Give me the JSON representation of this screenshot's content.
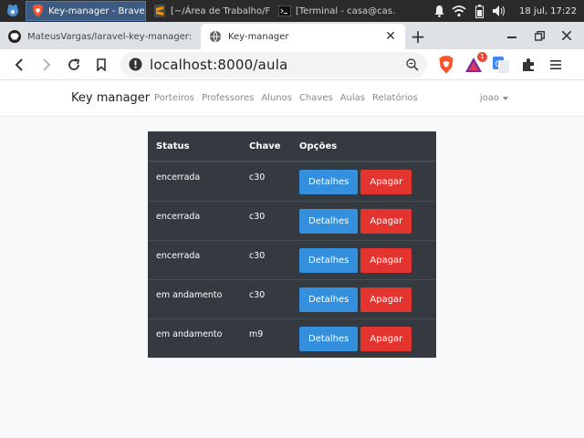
{
  "taskbar": {
    "tasks": [
      {
        "icon": "brave-icon",
        "title": "Key-manager - Brave",
        "active": true
      },
      {
        "icon": "sublime-text-icon",
        "title": "[~/Área de Trabalho/F…",
        "active": false
      },
      {
        "icon": "terminal-icon",
        "title": "[Terminal - casa@cas…",
        "active": false
      }
    ],
    "clock": "18 jul, 17:22"
  },
  "browser": {
    "tabs": [
      {
        "icon": "github-icon",
        "title": "MateusVargas/laravel-key-manager: Sister",
        "active": false
      },
      {
        "icon": "globe-icon",
        "title": "Key-manager",
        "active": true
      }
    ],
    "url": "localhost:8000/aula",
    "rewards_badge": "1"
  },
  "app": {
    "brand": "Key manager",
    "nav": [
      "Porteiros",
      "Professores",
      "Alunos",
      "Chaves",
      "Aulas",
      "Relatórios"
    ],
    "user": "joao"
  },
  "table": {
    "headers": {
      "status": "Status",
      "chave": "Chave",
      "opcoes": "Opções"
    },
    "rows": [
      {
        "status": "encerrada",
        "chave": "c30",
        "details": "Detalhes",
        "delete": "Apagar"
      },
      {
        "status": "encerrada",
        "chave": "c30",
        "details": "Detalhes",
        "delete": "Apagar"
      },
      {
        "status": "encerrada",
        "chave": "c30",
        "details": "Detalhes",
        "delete": "Apagar"
      },
      {
        "status": "em andamento",
        "chave": "c30",
        "details": "Detalhes",
        "delete": "Apagar"
      },
      {
        "status": "em andamento",
        "chave": "m9",
        "details": "Detalhes",
        "delete": "Apagar"
      }
    ]
  },
  "colors": {
    "table_bg": "#343a40",
    "btn_info": "#3490dc",
    "btn_danger": "#e3342f",
    "taskbar_bg": "#2b2b2b"
  }
}
